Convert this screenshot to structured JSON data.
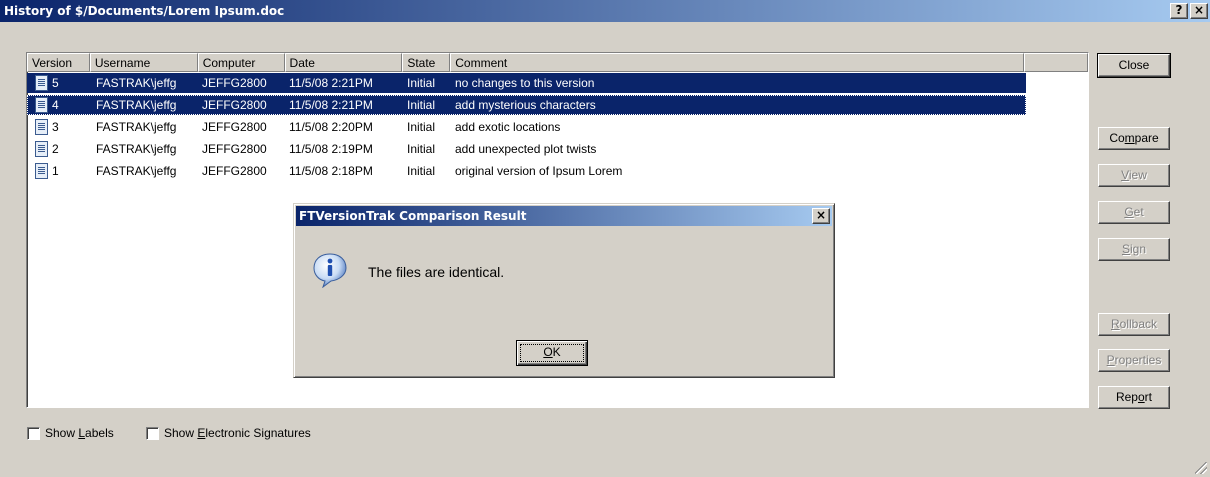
{
  "window": {
    "title": "History of $/Documents/Lorem Ipsum.doc",
    "help_glyph": "?",
    "close_glyph": "×"
  },
  "list": {
    "columns": [
      "Version",
      "Username",
      "Computer",
      "Date",
      "State",
      "Comment"
    ],
    "rows": [
      {
        "version": "5",
        "username": "FASTRAK\\jeffg",
        "computer": "JEFFG2800",
        "date": "11/5/08 2:21PM",
        "state": "Initial",
        "comment": "no changes to this version",
        "selected": true
      },
      {
        "version": "4",
        "username": "FASTRAK\\jeffg",
        "computer": "JEFFG2800",
        "date": "11/5/08 2:21PM",
        "state": "Initial",
        "comment": "add mysterious characters",
        "selected": true
      },
      {
        "version": "3",
        "username": "FASTRAK\\jeffg",
        "computer": "JEFFG2800",
        "date": "11/5/08 2:20PM",
        "state": "Initial",
        "comment": "add exotic locations",
        "selected": false
      },
      {
        "version": "2",
        "username": "FASTRAK\\jeffg",
        "computer": "JEFFG2800",
        "date": "11/5/08 2:19PM",
        "state": "Initial",
        "comment": "add unexpected plot twists",
        "selected": false
      },
      {
        "version": "1",
        "username": "FASTRAK\\jeffg",
        "computer": "JEFFG2800",
        "date": "11/5/08 2:18PM",
        "state": "Initial",
        "comment": "original version of Ipsum Lorem",
        "selected": false
      }
    ],
    "icon": "document-icon"
  },
  "buttons": {
    "close": {
      "pre": "Close",
      "acc": "",
      "post": ""
    },
    "compare": {
      "pre": "Co",
      "acc": "m",
      "post": "pare"
    },
    "view": {
      "pre": "",
      "acc": "V",
      "post": "iew"
    },
    "get": {
      "pre": "",
      "acc": "G",
      "post": "et"
    },
    "sign": {
      "pre": "",
      "acc": "S",
      "post": "ign"
    },
    "rollback": {
      "pre": "",
      "acc": "R",
      "post": "ollback"
    },
    "properties": {
      "pre": "",
      "acc": "P",
      "post": "roperties"
    },
    "report": {
      "pre": "Rep",
      "acc": "o",
      "post": "rt"
    }
  },
  "checkboxes": {
    "labels": {
      "pre": "Show ",
      "acc": "L",
      "post": "abels",
      "checked": false
    },
    "signatures": {
      "pre": "Show ",
      "acc": "E",
      "post": "lectronic Signatures",
      "checked": false
    }
  },
  "dialog": {
    "title": "FTVersionTrak Comparison Result",
    "message": "The files are identical.",
    "ok_pre": "",
    "ok_acc": "O",
    "ok_post": "K",
    "icon": "info-icon"
  },
  "colors": {
    "selection": "#0a246a",
    "face": "#d4d0c8"
  }
}
